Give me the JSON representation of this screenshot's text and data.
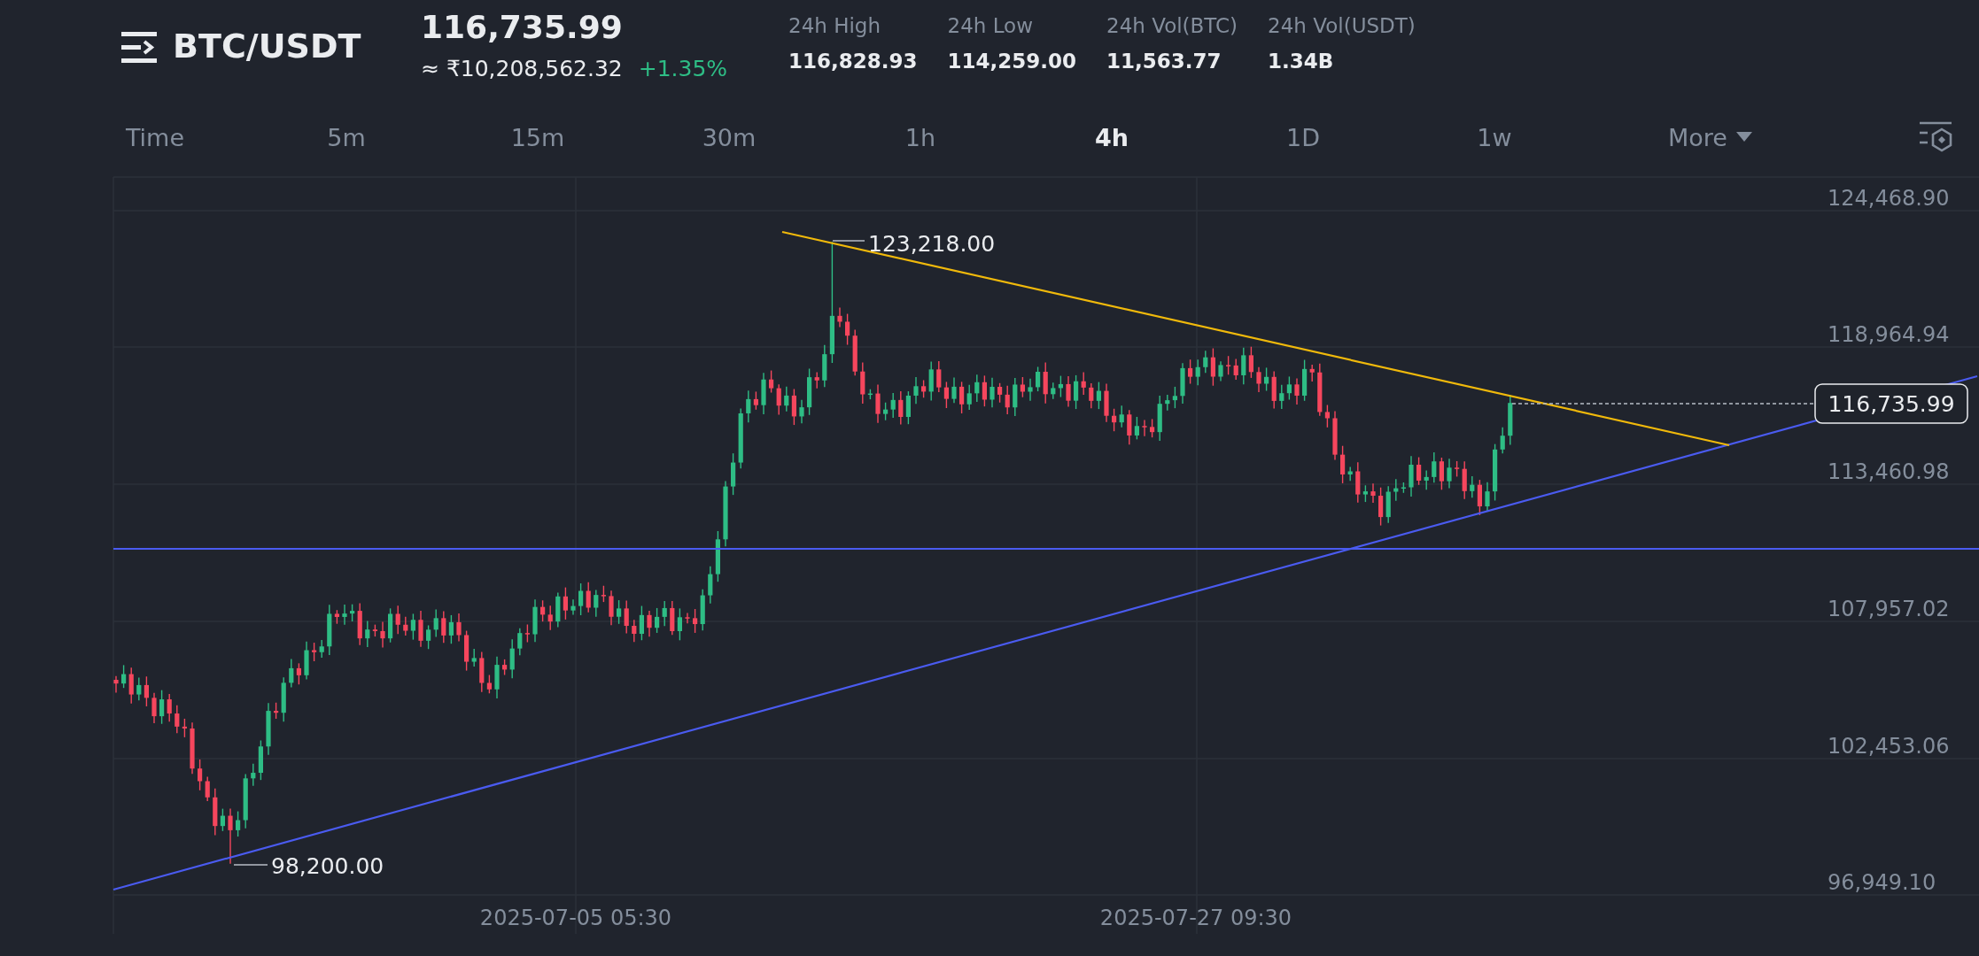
{
  "header": {
    "pair": "BTC/USDT",
    "price": "116,735.99",
    "fiat_price": "≈ ₹10,208,562.32",
    "change": "+1.35%"
  },
  "stats": [
    {
      "label": "24h High",
      "value": "116,828.93"
    },
    {
      "label": "24h Low",
      "value": "114,259.00"
    },
    {
      "label": "24h Vol(BTC)",
      "value": "11,563.77"
    },
    {
      "label": "24h Vol(USDT)",
      "value": "1.34B"
    }
  ],
  "intervals": [
    {
      "label": "Time",
      "selected": false
    },
    {
      "label": "5m",
      "selected": false
    },
    {
      "label": "15m",
      "selected": false
    },
    {
      "label": "30m",
      "selected": false
    },
    {
      "label": "1h",
      "selected": false
    },
    {
      "label": "4h",
      "selected": true
    },
    {
      "label": "1D",
      "selected": false
    },
    {
      "label": "1w",
      "selected": false
    }
  ],
  "more": {
    "label": "More"
  },
  "chart": {
    "y_ticks": [
      "124,468.90",
      "118,964.94",
      "113,460.98",
      "107,957.02",
      "102,453.06",
      "96,949.10"
    ],
    "x_labels": [
      "2025-07-05 05:30",
      "2025-07-27 09:30"
    ],
    "high_label": "123,218.00",
    "low_label": "98,200.00",
    "last_price": "116,735.99"
  }
}
